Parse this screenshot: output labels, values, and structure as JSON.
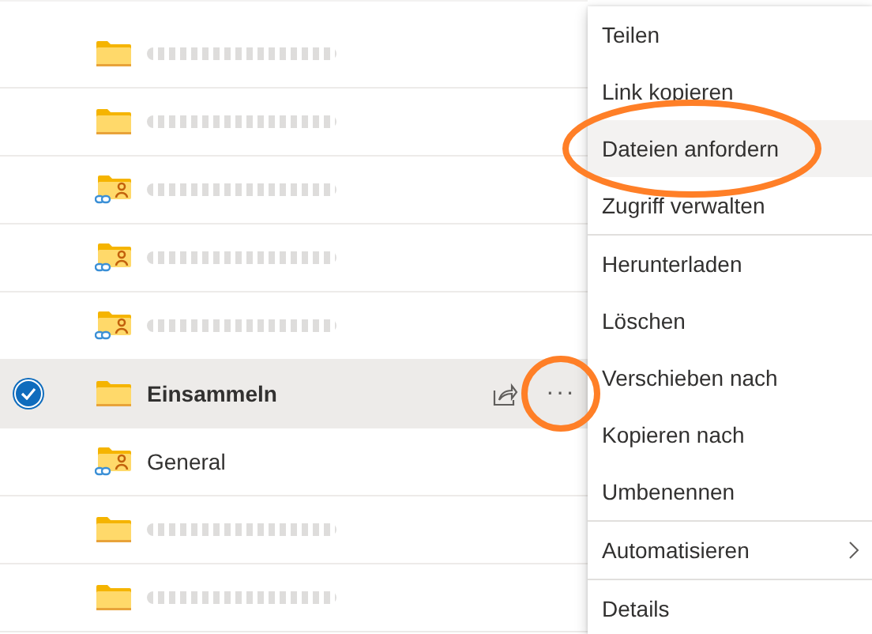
{
  "files": [
    {
      "kind": "folder",
      "selected": false
    },
    {
      "kind": "folder",
      "selected": false
    },
    {
      "kind": "shared-folder",
      "selected": false
    },
    {
      "kind": "shared-folder",
      "selected": false
    },
    {
      "kind": "shared-folder",
      "selected": false
    },
    {
      "kind": "folder",
      "name": "Einsammeln",
      "selected": true
    },
    {
      "kind": "shared-folder",
      "name": "General",
      "selected": false
    },
    {
      "kind": "folder",
      "selected": false
    },
    {
      "kind": "folder",
      "selected": false
    }
  ],
  "row_actions": {
    "more": "···",
    "circled": true
  },
  "context_menu": {
    "groups": [
      [
        {
          "label": "Teilen",
          "highlighted": false
        },
        {
          "label": "Link kopieren",
          "highlighted": false
        },
        {
          "label": "Dateien anfordern",
          "highlighted": true,
          "circled": true
        },
        {
          "label": "Zugriff verwalten",
          "highlighted": false
        }
      ],
      [
        {
          "label": "Herunterladen",
          "highlighted": false
        },
        {
          "label": "Löschen",
          "highlighted": false
        },
        {
          "label": "Verschieben nach",
          "highlighted": false
        },
        {
          "label": "Kopieren nach",
          "highlighted": false
        },
        {
          "label": "Umbenennen",
          "highlighted": false
        }
      ],
      [
        {
          "label": "Automatisieren",
          "highlighted": false,
          "kind": "submenu"
        }
      ],
      [
        {
          "label": "Details",
          "highlighted": false
        }
      ]
    ]
  }
}
